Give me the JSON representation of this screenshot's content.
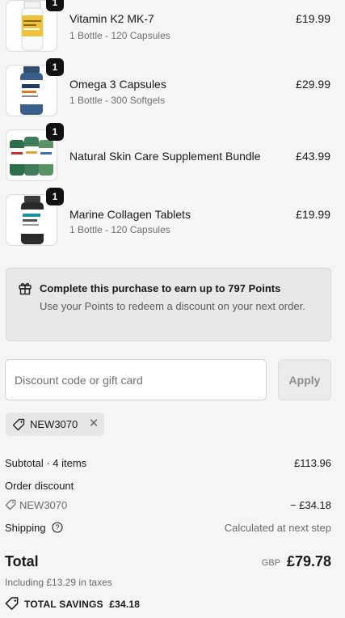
{
  "cart": {
    "items": [
      {
        "name": "Vitamin K2 MK-7",
        "variant": "1 Bottle - 120 Capsules",
        "price": "£19.99",
        "quantity": "1",
        "thumb": "bottle-yellow-icon"
      },
      {
        "name": "Omega 3 Capsules",
        "variant": "1 Bottle - 300 Softgels",
        "price": "£29.99",
        "quantity": "1",
        "thumb": "bottle-orange-icon"
      },
      {
        "name": "Natural Skin Care Supplement Bundle",
        "variant": "",
        "price": "£43.99",
        "quantity": "1",
        "thumb": "bundle-bottles-icon"
      },
      {
        "name": "Marine Collagen Tablets",
        "variant": "1 Bottle - 120 Capsules",
        "price": "£19.99",
        "quantity": "1",
        "thumb": "bottle-teal-icon"
      }
    ]
  },
  "points": {
    "title": "Complete this purchase to earn up to 797 Points",
    "subtitle": "Use your Points to redeem a discount on your next order.",
    "icon": "gift-icon"
  },
  "discount": {
    "placeholder": "Discount code or gift card",
    "apply_label": "Apply",
    "applied_code": "NEW3070"
  },
  "summary": {
    "subtotal_label": "Subtotal · 4 items",
    "subtotal_value": "£113.96",
    "order_discount_label": "Order discount",
    "discount_code": "NEW3070",
    "discount_value": "− £34.18",
    "shipping_label": "Shipping",
    "shipping_value": "Calculated at next step",
    "total_label": "Total",
    "currency": "GBP",
    "total_value": "£79.78",
    "tax_note": "Including £13.29 in taxes",
    "savings_label": "TOTAL SAVINGS",
    "savings_value": "£34.18"
  },
  "colors": {
    "background": "#f5f5f5",
    "badge": "#111111",
    "muted_text": "#6b6b6b"
  }
}
